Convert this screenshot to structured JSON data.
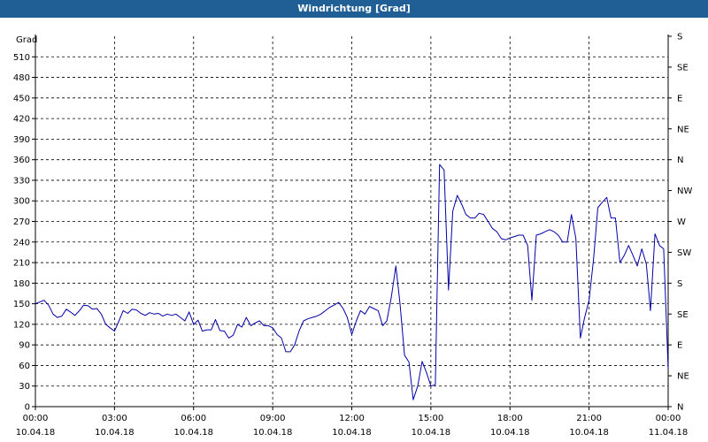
{
  "window": {
    "title": "Windrichtung [Grad]"
  },
  "chart_data": {
    "type": "line",
    "title": "Windrichtung [Grad]",
    "ylabel": "Grad",
    "xlabel": "",
    "ylim": [
      0,
      540
    ],
    "xlim_hours": [
      0,
      24
    ],
    "y_ticks": [
      0,
      30,
      60,
      90,
      120,
      150,
      180,
      210,
      240,
      270,
      300,
      330,
      360,
      390,
      420,
      450,
      480,
      510
    ],
    "right_axis_ticks": [
      {
        "y": 0,
        "label": "N"
      },
      {
        "y": 45,
        "label": "NE"
      },
      {
        "y": 90,
        "label": "E"
      },
      {
        "y": 135,
        "label": "SE"
      },
      {
        "y": 180,
        "label": "S"
      },
      {
        "y": 225,
        "label": "SW"
      },
      {
        "y": 270,
        "label": "W"
      },
      {
        "y": 315,
        "label": "NW"
      },
      {
        "y": 360,
        "label": "N"
      },
      {
        "y": 405,
        "label": "NE"
      },
      {
        "y": 450,
        "label": "E"
      },
      {
        "y": 495,
        "label": "SE"
      },
      {
        "y": 540,
        "label": "S"
      }
    ],
    "x_ticks": [
      {
        "h": 0,
        "time": "00:00",
        "date": "10.04.18"
      },
      {
        "h": 3,
        "time": "03:00",
        "date": "10.04.18"
      },
      {
        "h": 6,
        "time": "06:00",
        "date": "10.04.18"
      },
      {
        "h": 9,
        "time": "09:00",
        "date": "10.04.18"
      },
      {
        "h": 12,
        "time": "12:00",
        "date": "10.04.18"
      },
      {
        "h": 15,
        "time": "15:00",
        "date": "10.04.18"
      },
      {
        "h": 18,
        "time": "18:00",
        "date": "10.04.18"
      },
      {
        "h": 21,
        "time": "21:00",
        "date": "10.04.18"
      },
      {
        "h": 24,
        "time": "00:00",
        "date": "11.04.18"
      }
    ],
    "grid": true,
    "colors": {
      "line": "#0000aa",
      "grid": "#000000",
      "title_bar": "#1f5f95"
    },
    "series": [
      {
        "x": [
          0.0,
          0.33,
          0.5,
          0.67,
          0.83,
          1.0,
          1.17,
          1.33,
          1.5,
          1.67,
          1.83,
          2.0,
          2.17,
          2.33,
          2.5,
          2.67,
          2.83,
          3.0,
          3.17,
          3.33,
          3.5,
          3.67,
          3.83,
          4.0,
          4.17,
          4.33,
          4.5,
          4.67,
          4.83,
          5.0,
          5.17,
          5.33,
          5.5,
          5.67,
          5.83,
          6.0,
          6.17,
          6.33,
          6.5,
          6.67,
          6.83,
          7.0,
          7.17,
          7.33,
          7.5,
          7.67,
          7.83,
          8.0,
          8.17,
          8.33,
          8.5,
          8.67,
          8.83,
          9.0,
          9.17,
          9.33,
          9.5,
          9.67,
          9.83,
          10.0,
          10.17,
          10.33,
          10.5,
          10.67,
          10.83,
          11.0,
          11.17,
          11.33,
          11.5,
          11.67,
          11.83,
          12.0,
          12.17,
          12.33,
          12.5,
          12.67,
          12.83,
          13.0,
          13.17,
          13.33,
          13.5,
          13.67,
          13.83,
          14.0,
          14.17,
          14.33,
          14.5,
          14.67,
          14.83,
          15.0,
          15.17,
          15.33,
          15.5,
          15.67,
          15.83,
          16.0,
          16.17,
          16.33,
          16.5,
          16.67,
          16.83,
          17.0,
          17.17,
          17.33,
          17.5,
          17.67,
          17.83,
          18.0,
          18.17,
          18.33,
          18.5,
          18.67,
          18.83,
          19.0,
          19.17,
          19.33,
          19.5,
          19.67,
          19.83,
          20.0,
          20.17,
          20.33,
          20.5,
          20.67,
          20.83,
          21.0,
          21.17,
          21.33,
          21.5,
          21.67,
          21.83,
          22.0,
          22.17,
          22.33,
          22.5,
          22.67,
          22.83,
          23.0,
          23.17,
          23.33,
          23.5,
          23.67,
          23.83,
          24.0
        ],
        "y": [
          150,
          155,
          148,
          135,
          130,
          132,
          142,
          138,
          133,
          140,
          148,
          147,
          142,
          143,
          135,
          120,
          115,
          110,
          125,
          140,
          136,
          142,
          141,
          136,
          133,
          137,
          135,
          136,
          132,
          135,
          133,
          135,
          130,
          125,
          138,
          120,
          126,
          110,
          112,
          112,
          127,
          111,
          110,
          100,
          104,
          120,
          116,
          130,
          118,
          122,
          125,
          118,
          118,
          115,
          105,
          100,
          80,
          80,
          90,
          110,
          125,
          128,
          130,
          132,
          135,
          140,
          145,
          148,
          152,
          143,
          130,
          105,
          125,
          140,
          135,
          146,
          143,
          140,
          118,
          125,
          160,
          205,
          150,
          75,
          65,
          10,
          30,
          66,
          50,
          30,
          32,
          353,
          345,
          170,
          285,
          308,
          295,
          280,
          275,
          275,
          282,
          280,
          270,
          260,
          255,
          245,
          243,
          246,
          248,
          250,
          250,
          235,
          155,
          250,
          252,
          255,
          258,
          255,
          250,
          240,
          240,
          280,
          245,
          100,
          130,
          155,
          215,
          290,
          298,
          305,
          275,
          275,
          210,
          220,
          235,
          220,
          205,
          230,
          208,
          140,
          252,
          235,
          230,
          55
        ]
      }
    ]
  }
}
